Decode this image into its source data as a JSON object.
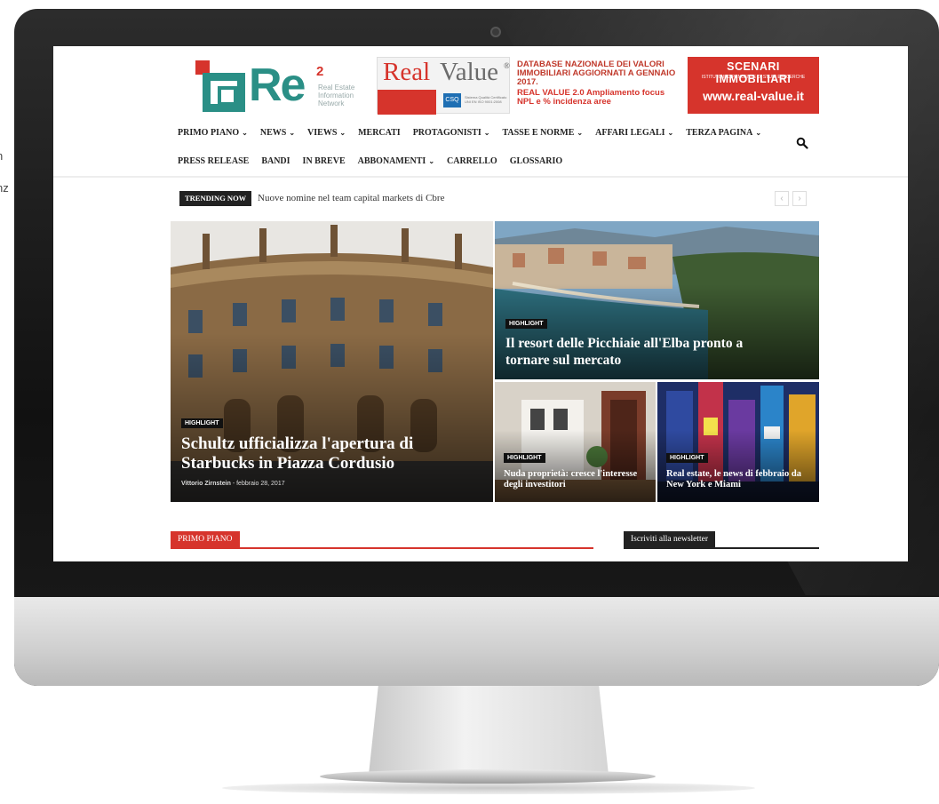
{
  "edge_text": {
    "line1": "n",
    "line2": "nz"
  },
  "site": {
    "logo": {
      "text": "Re",
      "superscript": "2",
      "tagline": "Real Estate\nInformation\nNetwork"
    },
    "ad": {
      "brand_real": "Real",
      "brand_value": "Value",
      "brand_reg": "®",
      "cert_badge": "CSQ",
      "cert_text": "Sistema Qualità Certificato UNI EN ISO 9001:2008",
      "database_text": "DATABASE NAZIONALE DEI VALORI IMMOBILIARI AGGIORNATI A GENNAIO 2017.",
      "rv2_text": "REAL VALUE 2.0 Ampliamento focus NPL e % incidenza aree",
      "scenari_title": "SCENARI IMMOBILIARI",
      "scenari_subtitle": "ISTITUTO INDIPENDENTE DI STUDI E RICERCHE",
      "url": "www.real-value.it"
    },
    "nav_row1": [
      {
        "label": "PRIMO PIANO",
        "caret": "⌄"
      },
      {
        "label": "NEWS",
        "caret": "⌄"
      },
      {
        "label": "VIEWS",
        "caret": "⌄"
      },
      {
        "label": "MERCATI",
        "caret": ""
      },
      {
        "label": "PROTAGONISTI",
        "caret": "⌄"
      },
      {
        "label": "TASSE E NORME",
        "caret": "⌄"
      },
      {
        "label": "AFFARI LEGALI",
        "caret": "⌄"
      },
      {
        "label": "TERZA PAGINA",
        "caret": "⌄"
      }
    ],
    "nav_row2": [
      {
        "label": "PRESS RELEASE",
        "caret": ""
      },
      {
        "label": "BANDI",
        "caret": ""
      },
      {
        "label": "IN BREVE",
        "caret": ""
      },
      {
        "label": "ABBONAMENTI",
        "caret": "⌄"
      },
      {
        "label": "CARRELLO",
        "caret": ""
      },
      {
        "label": "GLOSSARIO",
        "caret": ""
      }
    ],
    "trending": {
      "label": "TRENDING NOW",
      "text": "Nuove nomine nel team capital markets di Cbre",
      "prev": "‹",
      "next": "›"
    },
    "featured": {
      "main": {
        "badge": "HIGHLIGHT",
        "title": "Schultz ufficializza l'apertura di Starbucks in Piazza Cordusio",
        "author": "Vittorio Zirnstein",
        "date": "febbraio 28, 2017"
      },
      "top_right": {
        "badge": "HIGHLIGHT",
        "title": "Il resort delle Picchiaie all'Elba pronto a tornare sul mercato"
      },
      "bottom_left": {
        "badge": "HIGHLIGHT",
        "title": "Nuda proprietà: cresce l'interesse degli investitori"
      },
      "bottom_right": {
        "badge": "HIGHLIGHT",
        "title": "Real estate, le news di febbraio da New York e Miami"
      }
    },
    "sections": {
      "primo_piano": "PRIMO PIANO",
      "newsletter": "Iscriviti alla newsletter"
    },
    "colors": {
      "brand_teal": "#2a8f86",
      "brand_red": "#d6342c",
      "dark": "#222222"
    }
  }
}
